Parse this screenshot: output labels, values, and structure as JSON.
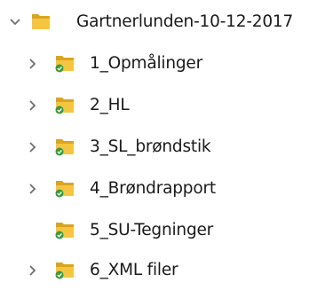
{
  "tree": {
    "root": {
      "label": "Gartnerlunden-10-12-2017",
      "expanded": true,
      "icon": "folder-icon",
      "synced": false
    },
    "children": [
      {
        "label": "1_Opmålinger",
        "has_children": true,
        "icon": "folder-icon",
        "status_icon": "sync-ok-icon"
      },
      {
        "label": "2_HL",
        "has_children": true,
        "icon": "folder-icon",
        "status_icon": "sync-ok-icon"
      },
      {
        "label": "3_SL_brøndstik",
        "has_children": true,
        "icon": "folder-icon",
        "status_icon": "sync-ok-icon"
      },
      {
        "label": "4_Brøndrapport",
        "has_children": true,
        "icon": "folder-icon",
        "status_icon": "sync-ok-icon"
      },
      {
        "label": "5_SU-Tegninger",
        "has_children": false,
        "icon": "folder-icon",
        "status_icon": "sync-ok-icon"
      },
      {
        "label": "6_XML filer",
        "has_children": true,
        "icon": "folder-icon",
        "status_icon": "sync-ok-icon"
      }
    ]
  },
  "colors": {
    "folder_back": "#d9a520",
    "folder_front": "#f5c542",
    "sync_green": "#3a9a3a",
    "chevron": "#6e6e6e"
  }
}
